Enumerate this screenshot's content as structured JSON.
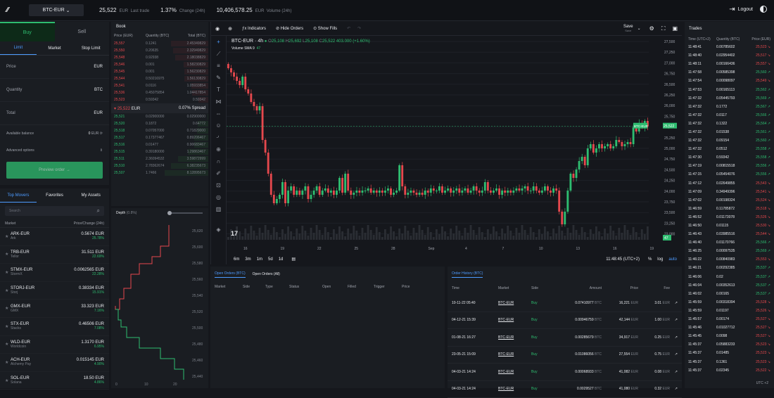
{
  "topbar": {
    "pair": "BTC-EUR",
    "last_trade_value": "25,522",
    "last_trade_unit": "EUR",
    "last_trade_label": "Last trade",
    "change_value": "1.37%",
    "change_label": "Change (24h)",
    "volume_value": "10,406,578.25",
    "volume_unit": "EUR",
    "volume_label": "Volume (24h)",
    "logout": "Logout"
  },
  "order": {
    "buy": "Buy",
    "sell": "Sell",
    "types": [
      "Limit",
      "Market",
      "Stop Limit"
    ],
    "price_label": "Price",
    "price_unit": "EUR",
    "qty_label": "Quantity",
    "qty_unit": "BTC",
    "total_label": "Total",
    "total_unit": "EUR",
    "avail_label": "Available balance",
    "avail_value": "0",
    "avail_unit": "EUR",
    "advanced": "Advanced options",
    "preview": "Preview order"
  },
  "movers": {
    "tabs": [
      "Top Movers",
      "Favorites",
      "My Assets"
    ],
    "search": "Search",
    "col_market": "Market",
    "col_price": "Price/Change (24h)",
    "rows": [
      {
        "pair": "ARK-EUR",
        "name": "Ark",
        "price": "0.5674 EUR",
        "change": "25.78%"
      },
      {
        "pair": "TRB-EUR",
        "name": "Tellor",
        "price": "31.511 EUR",
        "change": "22.69%"
      },
      {
        "pair": "STMX-EUR",
        "name": "StormX",
        "price": "0.0062565 EUR",
        "change": "22.28%"
      },
      {
        "pair": "STORJ-EUR",
        "name": "Storj",
        "price": "0.38334 EUR",
        "change": "15.91%"
      },
      {
        "pair": "GMX-EUR",
        "name": "GMX",
        "price": "33.323 EUR",
        "change": "7.16%"
      },
      {
        "pair": "STX-EUR",
        "name": "Stacks",
        "price": "0.46506 EUR",
        "change": "7.08%"
      },
      {
        "pair": "WLD-EUR",
        "name": "Worldcoin",
        "price": "1.3170 EUR",
        "change": "6.95%"
      },
      {
        "pair": "ACH-EUR",
        "name": "Alchemy Pay",
        "price": "0.015145 EUR",
        "change": "4.90%"
      },
      {
        "pair": "SOL-EUR",
        "name": "Solana",
        "price": "18.50 EUR",
        "change": "4.86%"
      }
    ]
  },
  "book": {
    "title": "Book",
    "col_price": "Price (EUR)",
    "col_qty": "Quantity (BTC)",
    "col_total": "Total (BTC)",
    "asks": [
      {
        "p": "25,557",
        "q": "0.1241",
        "t": "2.45349829",
        "d": 0.85
      },
      {
        "p": "25,550",
        "q": "0.20635",
        "t": "2.32949829",
        "d": 0.8
      },
      {
        "p": "25,548",
        "q": "0.92938",
        "t": "2.18038829",
        "d": 0.76
      },
      {
        "p": "25,546",
        "q": "0.001",
        "t": "1.58230829",
        "d": 0.56
      },
      {
        "p": "25,545",
        "q": "0.001",
        "t": "1.56230829",
        "d": 0.55
      },
      {
        "p": "25,544",
        "q": "0.50216975",
        "t": "1.56130829",
        "d": 0.55
      },
      {
        "p": "25,541",
        "q": "0.0116",
        "t": "1.05933854",
        "d": 0.38
      },
      {
        "p": "25,536",
        "q": "0.45075854",
        "t": "1.04417854",
        "d": 0.37
      },
      {
        "p": "25,523",
        "q": "0.59342",
        "t": "0.59342",
        "d": 0.22
      }
    ],
    "mid": "25,522",
    "mid_unit": "EUR",
    "spread": "0.07% Spread",
    "bids": [
      {
        "p": "25,521",
        "q": "0.02900000",
        "t": "0.02900000",
        "d": 0.02
      },
      {
        "p": "25,520",
        "q": "0.1872",
        "t": "0.64772",
        "d": 0.24
      },
      {
        "p": "25,518",
        "q": "0.07057000",
        "t": "0.71829000",
        "d": 0.26
      },
      {
        "p": "25,517",
        "q": "0.17377467",
        "t": "0.89206467",
        "d": 0.32
      },
      {
        "p": "25,516",
        "q": "0.01477",
        "t": "0.90683467",
        "d": 0.33
      },
      {
        "p": "25,515",
        "q": "0.39180000",
        "t": "1.29863467",
        "d": 0.46
      },
      {
        "p": "25,511",
        "q": "2.36094532",
        "t": "3.59872999",
        "d": 0.7
      },
      {
        "p": "25,510",
        "q": "2.78362674",
        "t": "6.38235673",
        "d": 0.85
      },
      {
        "p": "25,507",
        "q": "1.7466",
        "t": "8.12895673",
        "d": 1.0
      }
    ]
  },
  "depth": {
    "title": "Depth",
    "zoom": "(0.8%)",
    "yticks": [
      "25,620",
      "25,600",
      "25,580",
      "25,560",
      "25,540",
      "25,520",
      "25,500",
      "25,480",
      "25,460",
      "25,440"
    ],
    "xticks": [
      "0",
      "10",
      "20"
    ]
  },
  "chart": {
    "indicators": "Indicators",
    "hide_orders": "Hide Orders",
    "show_fills": "Show Fills",
    "save": "Save",
    "save_sub": "Save",
    "symbol": "BTC-EUR · 4h",
    "O": "25,108",
    "H": "25,692",
    "L": "25,108",
    "C": "25,522",
    "chg": "403.000 (+1.60%)",
    "sma": "Volume SMA 9",
    "sma_val": "47",
    "price_tag": "25,522",
    "price_tag_label": "BTC-EUR",
    "vol_tag": "47",
    "yticks": [
      "27,500",
      "27,250",
      "27,000",
      "26,750",
      "26,500",
      "26,250",
      "26,000",
      "25,750",
      "25,500",
      "25,250",
      "25,000",
      "24,750",
      "24,500",
      "24,250",
      "24,000",
      "23,750",
      "23,500",
      "23,250",
      "23,000"
    ],
    "xticks": [
      "16",
      "19",
      "22",
      "25",
      "28",
      "Sep",
      "4",
      "7",
      "10",
      "13",
      "16",
      "19"
    ],
    "ranges": [
      "6m",
      "3m",
      "1m",
      "5d",
      "1d"
    ],
    "time": "11:48:45 (UTC+2)",
    "pct": "%",
    "log": "log",
    "auto": "auto"
  },
  "chart_data": {
    "type": "candlestick",
    "ylim": [
      23000,
      27500
    ],
    "closes": [
      26900,
      26800,
      26700,
      26600,
      26500,
      26700,
      26400,
      26300,
      26100,
      26000,
      25900,
      26000,
      25200,
      24900,
      24400,
      23900,
      23700,
      23800,
      23900,
      24200,
      23700,
      24000,
      24100,
      23900,
      24000,
      23900,
      24000,
      24100,
      23800,
      23900,
      24000,
      24100,
      23900,
      24000,
      24050,
      23950,
      24000,
      23900,
      24000,
      24300,
      23950,
      24400,
      24000,
      23900,
      23950,
      24000,
      23950,
      24000,
      24000,
      24050,
      23950,
      24000,
      23950,
      24000,
      23950,
      24000,
      24050,
      23900,
      23950,
      24000,
      24600,
      24100,
      23900,
      23950,
      24000,
      23950,
      23900,
      23950,
      23900,
      24000,
      23950,
      24050,
      24000,
      24000,
      24100,
      23950,
      24000,
      24050,
      23950,
      24000,
      24050,
      23950,
      24000,
      24050,
      23950,
      24000,
      24100,
      24000,
      23950,
      24000,
      24200,
      24000,
      23950,
      24000,
      24050,
      23900,
      24000,
      23950,
      24000,
      23950,
      24000,
      24050,
      24000,
      24050,
      24100,
      24000,
      24000,
      24100,
      24000,
      23950,
      24000,
      24100,
      24000,
      23950,
      24050,
      24000,
      23500,
      23200,
      23500,
      24000,
      24400,
      24300,
      24500,
      24700,
      24800,
      24600,
      25000,
      25100,
      24900,
      25000,
      25100,
      25000,
      25050,
      25100,
      25000,
      25050,
      25200,
      25150,
      25050,
      25100,
      25150,
      25100,
      25500,
      25400,
      25600,
      25500,
      25650,
      25522
    ]
  },
  "openorders": {
    "tabs": [
      "Open Orders (BTC)",
      "Open Orders (All)"
    ],
    "cols": [
      "Market",
      "Side",
      "Type",
      "Status",
      "Open",
      "Filled",
      "Trigger",
      "Price"
    ]
  },
  "orderhist": {
    "tab": "Order History (BTC)",
    "cols": [
      "Time",
      "Market",
      "Side",
      "Amount",
      "Price",
      "Fee"
    ],
    "rows": [
      {
        "time": "10-11-22 05:40",
        "market": "BTC-EUR",
        "side": "Buy",
        "amount": "0.07410977",
        "au": "BTC",
        "price": "16,221",
        "pu": "EUR",
        "fee": "3.01",
        "fu": "EUR"
      },
      {
        "time": "04-12-21 15:39",
        "market": "BTC-EUR",
        "side": "Buy",
        "amount": "0.00946759",
        "au": "BTC",
        "price": "42,144",
        "pu": "EUR",
        "fee": "1.00",
        "fu": "EUR"
      },
      {
        "time": "01-08-21 16:27",
        "market": "BTC-EUR",
        "side": "Buy",
        "amount": "0.00285679",
        "au": "BTC",
        "price": "34,917",
        "pu": "EUR",
        "fee": "0.25",
        "fu": "EUR"
      },
      {
        "time": "23-05-21 15:09",
        "market": "BTC-EUR",
        "side": "Buy",
        "amount": "0.01086056",
        "au": "BTC",
        "price": "27,554",
        "pu": "EUR",
        "fee": "0.75",
        "fu": "EUR"
      },
      {
        "time": "04-03-21 14:24",
        "market": "BTC-EUR",
        "side": "Buy",
        "amount": "0.00068933",
        "au": "BTC",
        "price": "41,082",
        "pu": "EUR",
        "fee": "0.08",
        "fu": "EUR"
      },
      {
        "time": "04-03-21 14:24",
        "market": "BTC-EUR",
        "side": "Buy",
        "amount": "0.0029527",
        "au": "BTC",
        "price": "41,080",
        "pu": "EUR",
        "fee": "0.32",
        "fu": "EUR"
      }
    ]
  },
  "trades": {
    "title": "Trades",
    "col_time": "Time (UTC+2)",
    "col_qty": "Quantity (BTC)",
    "col_price": "Price (EUR)",
    "footer": "UTC +2",
    "rows": [
      {
        "t": "11:48:41",
        "q": "0.00785602",
        "p": "25,523",
        "s": "r"
      },
      {
        "t": "11:48:40",
        "q": "0.02954402",
        "p": "25,517",
        "s": "r"
      },
      {
        "t": "11:48:11",
        "q": "0.00166436",
        "p": "25,557",
        "s": "r"
      },
      {
        "t": "11:47:58",
        "q": "0.00585398",
        "p": "25,560",
        "s": "g"
      },
      {
        "t": "11:47:54",
        "q": "0.00098097",
        "p": "25,549",
        "s": "r"
      },
      {
        "t": "11:47:53",
        "q": "0.00165113",
        "p": "25,562",
        "s": "g"
      },
      {
        "t": "11:47:32",
        "q": "0.05445793",
        "p": "25,569",
        "s": "g"
      },
      {
        "t": "11:47:32",
        "q": "0.1772",
        "p": "25,567",
        "s": "g"
      },
      {
        "t": "11:47:32",
        "q": "0.0117",
        "p": "25,566",
        "s": "g"
      },
      {
        "t": "11:47:32",
        "q": "0.1322",
        "p": "25,564",
        "s": "g"
      },
      {
        "t": "11:47:32",
        "q": "0.01538",
        "p": "25,561",
        "s": "g"
      },
      {
        "t": "11:47:32",
        "q": "0.09154",
        "p": "25,560",
        "s": "g"
      },
      {
        "t": "11:47:32",
        "q": "0.0512",
        "p": "25,558",
        "s": "g"
      },
      {
        "t": "11:47:30",
        "q": "0.59342",
        "p": "25,558",
        "s": "g"
      },
      {
        "t": "11:47:19",
        "q": "0.00815518",
        "p": "25,556",
        "s": "g"
      },
      {
        "t": "11:47:15",
        "q": "0.05454076",
        "p": "25,556",
        "s": "g"
      },
      {
        "t": "11:47:12",
        "q": "0.02649855",
        "p": "25,543",
        "s": "r"
      },
      {
        "t": "11:47:09",
        "q": "0.34949396",
        "p": "25,541",
        "s": "r"
      },
      {
        "t": "11:47:02",
        "q": "0.00198324",
        "p": "25,524",
        "s": "r"
      },
      {
        "t": "11:46:59",
        "q": "0.11785872",
        "p": "25,518",
        "s": "r"
      },
      {
        "t": "11:46:52",
        "q": "0.01173078",
        "p": "25,526",
        "s": "r"
      },
      {
        "t": "11:46:50",
        "q": "0.01115",
        "p": "25,530",
        "s": "r"
      },
      {
        "t": "11:46:43",
        "q": "0.03985516",
        "p": "25,544",
        "s": "r"
      },
      {
        "t": "11:46:40",
        "q": "0.01170766",
        "p": "25,566",
        "s": "g"
      },
      {
        "t": "11:46:25",
        "q": "0.00097535",
        "p": "25,569",
        "s": "g"
      },
      {
        "t": "11:46:22",
        "q": "0.00840983",
        "p": "25,553",
        "s": "r"
      },
      {
        "t": "11:46:21",
        "q": "0.00292385",
        "p": "25,537",
        "s": "g"
      },
      {
        "t": "11:46:06",
        "q": "0.02",
        "p": "25,537",
        "s": "g"
      },
      {
        "t": "11:46:04",
        "q": "0.00352613",
        "p": "25,537",
        "s": "g"
      },
      {
        "t": "11:46:02",
        "q": "0.00165",
        "p": "25,537",
        "s": "g"
      },
      {
        "t": "11:45:59",
        "q": "0.00318394",
        "p": "25,528",
        "s": "r"
      },
      {
        "t": "11:45:59",
        "q": "0.01197",
        "p": "25,526",
        "s": "r"
      },
      {
        "t": "11:45:57",
        "q": "0.00174",
        "p": "25,527",
        "s": "r"
      },
      {
        "t": "11:45:46",
        "q": "0.01027712",
        "p": "25,527",
        "s": "r"
      },
      {
        "t": "11:45:45",
        "q": "0.0098",
        "p": "25,527",
        "s": "r"
      },
      {
        "t": "11:45:37",
        "q": "0.05883233",
        "p": "25,523",
        "s": "r"
      },
      {
        "t": "11:45:37",
        "q": "0.01485",
        "p": "25,523",
        "s": "r"
      },
      {
        "t": "11:45:37",
        "q": "0.1361",
        "p": "25,523",
        "s": "r"
      },
      {
        "t": "11:45:37",
        "q": "0.02345",
        "p": "25,522",
        "s": "r"
      }
    ]
  }
}
